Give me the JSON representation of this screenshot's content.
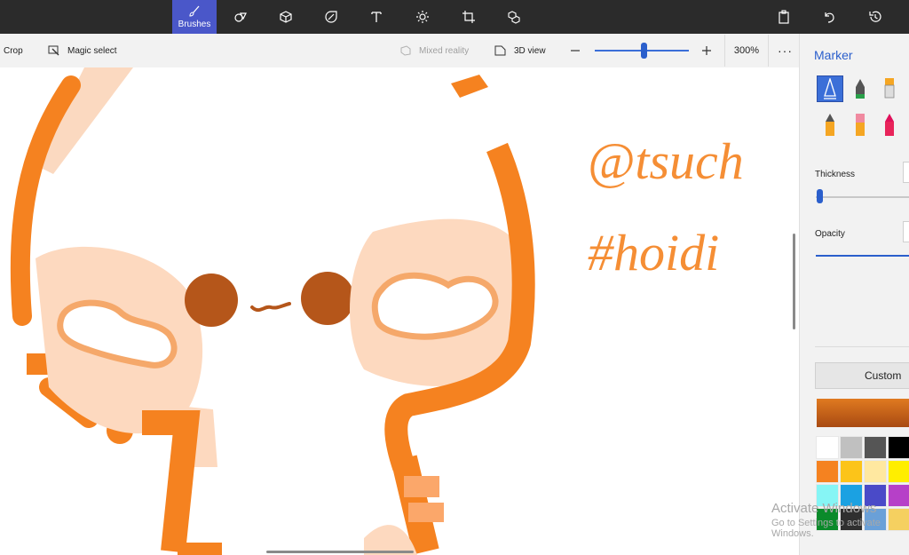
{
  "topbar": {
    "tools": [
      {
        "name": "brushes-tool",
        "icon": "brush-icon",
        "label": "Brushes",
        "active": true
      },
      {
        "name": "2d-shapes-tool",
        "icon": "shapes-icon",
        "label": "",
        "active": false
      },
      {
        "name": "3d-shapes-tool",
        "icon": "cube-icon",
        "label": "",
        "active": false
      },
      {
        "name": "stickers-tool",
        "icon": "sticker-icon",
        "label": "",
        "active": false
      },
      {
        "name": "text-tool",
        "icon": "text-icon",
        "label": "",
        "active": false
      },
      {
        "name": "effects-tool",
        "icon": "effects-icon",
        "label": "",
        "active": false
      },
      {
        "name": "canvas-tool",
        "icon": "canvas-icon",
        "label": "",
        "active": false
      },
      {
        "name": "3d-library-tool",
        "icon": "3d-library-icon",
        "label": "",
        "active": false
      }
    ],
    "right_icons": [
      "paste-icon",
      "undo-icon",
      "history-icon"
    ]
  },
  "toolbar": {
    "crop_label": "Crop",
    "magic_select_label": "Magic select",
    "mixed_reality_label": "Mixed reality",
    "view_3d_label": "3D view",
    "zoom_value": "300%",
    "zoom_level_fraction": 0.52,
    "more_label": "···"
  },
  "canvas": {
    "text_line1": "@tsuch",
    "text_line2": "#hoidi"
  },
  "panel": {
    "title": "Marker",
    "thickness_label": "Thickness",
    "opacity_label": "Opacity",
    "custom_label": "Custom",
    "brushes": [
      {
        "name": "calligraphy-pen-brush",
        "icon": "calligraphy-pen-icon",
        "selected": true
      },
      {
        "name": "ink-pen-brush",
        "icon": "fountain-pen-icon",
        "selected": false
      },
      {
        "name": "marker-brush",
        "icon": "marker-icon",
        "selected": false
      },
      {
        "name": "pencil-brush",
        "icon": "pencil-icon",
        "selected": false
      },
      {
        "name": "eraser-brush",
        "icon": "eraser-icon",
        "selected": false
      },
      {
        "name": "crayon-brush",
        "icon": "crayon-icon",
        "selected": false
      }
    ],
    "palette": [
      [
        "#ffffff",
        "#c0c0c0",
        "#555555",
        "#000000"
      ],
      [
        "#f58220",
        "#fcc419",
        "#ffe8a0",
        "#ffee00"
      ],
      [
        "#86f5f5",
        "#1ba1e2",
        "#4a4ac8",
        "#b640c8"
      ],
      [
        "#0a8a2a",
        "#2f2f2f",
        "#6aa0d8",
        "#f5d060"
      ]
    ]
  },
  "watermark": {
    "line1": "Activate Windows",
    "line2": "Go to Settings to activate Windows."
  }
}
